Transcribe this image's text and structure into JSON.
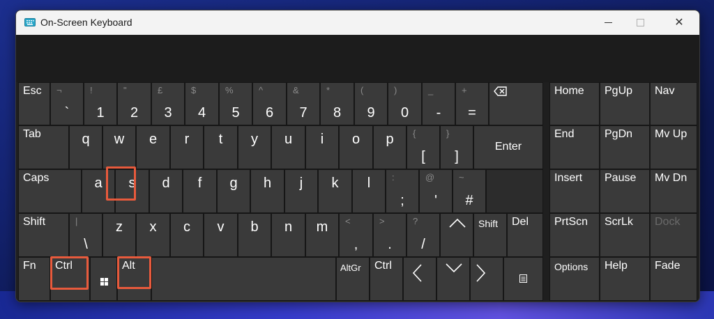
{
  "window": {
    "title": "On-Screen Keyboard",
    "close_glyph": "✕"
  },
  "colors": {
    "highlight": "#e85a3c",
    "key": "#3a3a3a",
    "background": "#1f1f1f"
  },
  "highlighted_keys": [
    "s",
    "Ctrl",
    "Alt"
  ],
  "rows": {
    "r1": [
      {
        "label": "Esc"
      },
      {
        "shift": "¬",
        "main": "`"
      },
      {
        "shift": "!",
        "main": "1"
      },
      {
        "shift": "\"",
        "main": "2"
      },
      {
        "shift": "£",
        "main": "3"
      },
      {
        "shift": "$",
        "main": "4"
      },
      {
        "shift": "%",
        "main": "5"
      },
      {
        "shift": "^",
        "main": "6"
      },
      {
        "shift": "&",
        "main": "7"
      },
      {
        "shift": "*",
        "main": "8"
      },
      {
        "shift": "(",
        "main": "9"
      },
      {
        "shift": ")",
        "main": "0"
      },
      {
        "shift": "_",
        "main": "-"
      },
      {
        "shift": "+",
        "main": "="
      },
      {
        "icon": "backspace-icon"
      }
    ],
    "r2": [
      {
        "label": "Tab"
      },
      {
        "main": "q"
      },
      {
        "main": "w"
      },
      {
        "main": "e"
      },
      {
        "main": "r"
      },
      {
        "main": "t"
      },
      {
        "main": "y"
      },
      {
        "main": "u"
      },
      {
        "main": "i"
      },
      {
        "main": "o"
      },
      {
        "main": "p"
      },
      {
        "shift": "{",
        "main": "["
      },
      {
        "shift": "}",
        "main": "]"
      },
      {
        "label": "Enter"
      }
    ],
    "r3": [
      {
        "label": "Caps"
      },
      {
        "main": "a"
      },
      {
        "main": "s"
      },
      {
        "main": "d"
      },
      {
        "main": "f"
      },
      {
        "main": "g"
      },
      {
        "main": "h"
      },
      {
        "main": "j"
      },
      {
        "main": "k"
      },
      {
        "main": "l"
      },
      {
        "shift": ":",
        "main": ";"
      },
      {
        "shift": "@",
        "main": "'"
      },
      {
        "shift": "~",
        "main": "#"
      }
    ],
    "r4": [
      {
        "label": "Shift"
      },
      {
        "shift": "|",
        "main": "\\"
      },
      {
        "main": "z"
      },
      {
        "main": "x"
      },
      {
        "main": "c"
      },
      {
        "main": "v"
      },
      {
        "main": "b"
      },
      {
        "main": "n"
      },
      {
        "main": "m"
      },
      {
        "shift": "<",
        "main": ","
      },
      {
        "shift": ">",
        "main": "."
      },
      {
        "shift": "?",
        "main": "/"
      },
      {
        "icon": "arrow-up-icon"
      },
      {
        "label": "Shift"
      },
      {
        "label": "Del"
      }
    ],
    "r5": [
      {
        "label": "Fn"
      },
      {
        "label": "Ctrl"
      },
      {
        "icon": "windows-icon"
      },
      {
        "label": "Alt"
      },
      {
        "label": ""
      },
      {
        "label": "AltGr"
      },
      {
        "label": "Ctrl"
      },
      {
        "icon": "arrow-left-icon"
      },
      {
        "icon": "arrow-down-icon"
      },
      {
        "icon": "arrow-right-icon"
      },
      {
        "icon": "menu-icon"
      }
    ]
  },
  "nav": [
    [
      "Home",
      "PgUp",
      "Nav"
    ],
    [
      "End",
      "PgDn",
      "Mv Up"
    ],
    [
      "Insert",
      "Pause",
      "Mv Dn"
    ],
    [
      "PrtScn",
      "ScrLk",
      "Dock"
    ],
    [
      "Options",
      "Help",
      "Fade"
    ]
  ]
}
